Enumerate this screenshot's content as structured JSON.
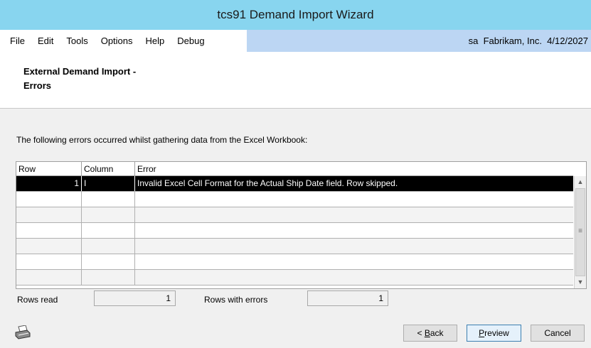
{
  "window": {
    "title": "tcs91 Demand Import Wizard"
  },
  "menu": {
    "items": [
      "File",
      "Edit",
      "Tools",
      "Options",
      "Help",
      "Debug"
    ],
    "status": "sa  Fabrikam, Inc.  4/12/2027"
  },
  "header": {
    "line1": "External Demand Import -",
    "line2": "Errors"
  },
  "message": "The following errors occurred whilst gathering data from the Excel Workbook:",
  "grid": {
    "columns": [
      "Row",
      "Column",
      "Error"
    ],
    "rows": [
      {
        "row": "1",
        "column": "I",
        "error": "Invalid Excel Cell Format for the Actual Ship Date field. Row skipped.",
        "selected": true
      },
      {
        "row": "",
        "column": "",
        "error": ""
      },
      {
        "row": "",
        "column": "",
        "error": ""
      },
      {
        "row": "",
        "column": "",
        "error": ""
      },
      {
        "row": "",
        "column": "",
        "error": ""
      },
      {
        "row": "",
        "column": "",
        "error": ""
      },
      {
        "row": "",
        "column": "",
        "error": ""
      }
    ]
  },
  "totals": {
    "rows_read_label": "Rows read",
    "rows_read_value": "1",
    "rows_errors_label": "Rows with errors",
    "rows_errors_value": "1"
  },
  "buttons": {
    "back_prefix": "< ",
    "back_mnemonic": "B",
    "back_rest": "ack",
    "preview_mnemonic": "P",
    "preview_rest": "review",
    "cancel": "Cancel"
  },
  "icons": {
    "footer": "printer-icon",
    "scroll_up": "chevron-up-icon",
    "scroll_down": "chevron-down-icon"
  },
  "colors": {
    "titlebar": "#88d5ef",
    "menubar": "#bcd6f3",
    "selected_row": "#000000"
  }
}
